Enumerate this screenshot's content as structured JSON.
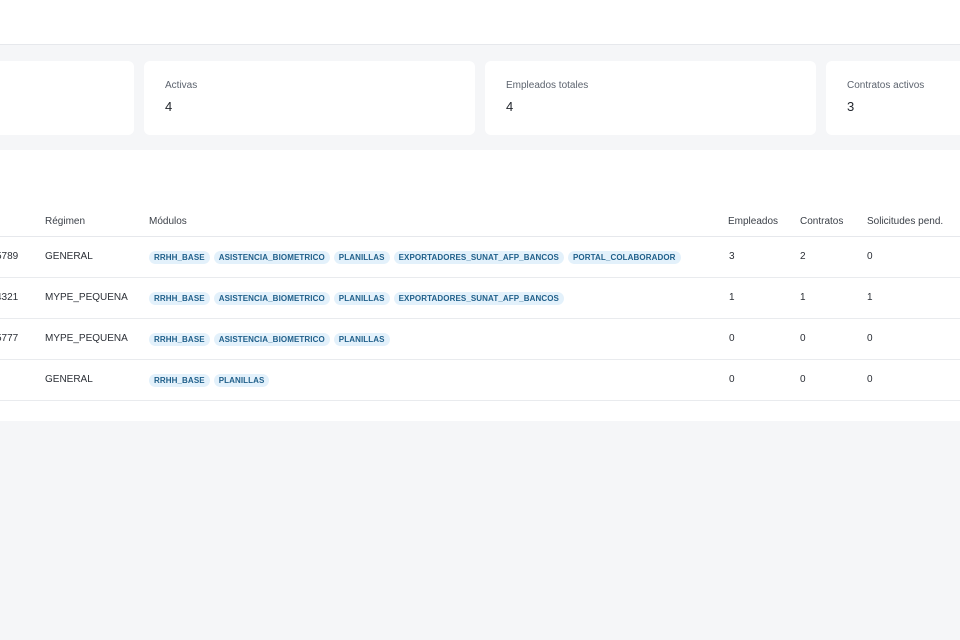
{
  "stats": [
    {
      "label": "",
      "value": ""
    },
    {
      "label": "Activas",
      "value": "4"
    },
    {
      "label": "Empleados totales",
      "value": "4"
    },
    {
      "label": "Contratos activos",
      "value": "3"
    }
  ],
  "table": {
    "headers": {
      "regimen": "Régimen",
      "modulos": "Módulos",
      "empleados": "Empleados",
      "contratos": "Contratos",
      "solicitudes": "Solicitudes pend."
    },
    "rows": [
      {
        "id_fragment": "5789",
        "regimen": "GENERAL",
        "modulos": [
          "RRHH_BASE",
          "ASISTENCIA_BIOMETRICO",
          "PLANILLAS",
          "EXPORTADORES_SUNAT_AFP_BANCOS",
          "PORTAL_COLABORADOR"
        ],
        "empleados": "3",
        "contratos": "2",
        "solicitudes": "0"
      },
      {
        "id_fragment": "4321",
        "regimen": "MYPE_PEQUENA",
        "modulos": [
          "RRHH_BASE",
          "ASISTENCIA_BIOMETRICO",
          "PLANILLAS",
          "EXPORTADORES_SUNAT_AFP_BANCOS"
        ],
        "empleados": "1",
        "contratos": "1",
        "solicitudes": "1"
      },
      {
        "id_fragment": "5777",
        "regimen": "MYPE_PEQUENA",
        "modulos": [
          "RRHH_BASE",
          "ASISTENCIA_BIOMETRICO",
          "PLANILLAS"
        ],
        "empleados": "0",
        "contratos": "0",
        "solicitudes": "0"
      },
      {
        "id_fragment": "",
        "regimen": "GENERAL",
        "modulos": [
          "RRHH_BASE",
          "PLANILLAS"
        ],
        "empleados": "0",
        "contratos": "0",
        "solicitudes": "0"
      }
    ]
  }
}
